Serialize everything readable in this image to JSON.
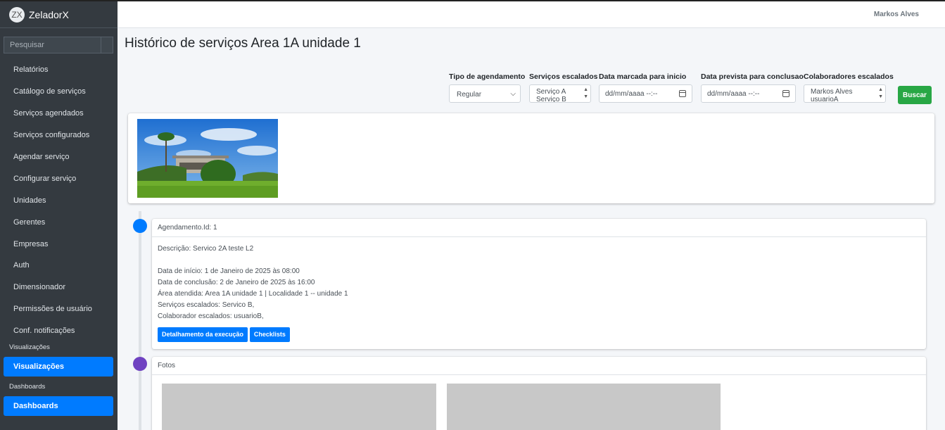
{
  "brand": {
    "logo": "ZX",
    "name": "ZeladorX"
  },
  "search": {
    "placeholder": "Pesquisar"
  },
  "nav": {
    "items": [
      "Relatórios",
      "Catálogo de serviços",
      "Serviços agendados",
      "Serviços configurados",
      "Agendar serviço",
      "Configurar serviço",
      "Unidades",
      "Gerentes",
      "Empresas",
      "Auth",
      "Dimensionador",
      "Permissões de usuário",
      "Conf. notificações"
    ],
    "section_visualizacoes": "Visualizações",
    "item_visualizacoes": "Visualizações",
    "section_dashboards": "Dashboards",
    "item_dashboards": "Dashboards"
  },
  "header": {
    "user": "Markos Alves"
  },
  "page": {
    "title": "Histórico de serviços Area 1A unidade 1"
  },
  "filters": {
    "tipo": {
      "label": "Tipo de agendamento",
      "value": "Regular"
    },
    "servicos": {
      "label": "Serviços escalados",
      "options": [
        "Serviço A",
        "Serviço B"
      ]
    },
    "data_inicio": {
      "label": "Data marcada para inicio",
      "placeholder": "dd/mm/aaaa --:--"
    },
    "data_fim": {
      "label": "Data prevista para conclusao",
      "placeholder": "dd/mm/aaaa --:--"
    },
    "colaboradores": {
      "label": "Colaboradores escalados",
      "options": [
        "Markos Alves",
        "usuarioA"
      ]
    },
    "buscar": "Buscar"
  },
  "timeline": {
    "agendamento": {
      "header": "Agendamento.Id: 1",
      "descricao": "Descrição: Servico 2A teste L2",
      "inicio": "Data de início: 1 de Janeiro de 2025 às 08:00",
      "conclusao": "Data de conclusão: 2 de Janeiro de 2025 às 16:00",
      "area": "Área atendida: Area 1A unidade 1 | Localidade 1 -- unidade 1",
      "servicos": "Serviços escalados: Servico B,",
      "colaborador": "Colaborador escalados: usuarioB,",
      "btn_detalhamento": "Detalhamento da execução",
      "btn_checklists": "Checklists"
    },
    "fotos": {
      "header": "Fotos"
    }
  },
  "colors": {
    "sidebar": "#343a40",
    "primary": "#007bff",
    "success": "#28a745",
    "dot1": "#007bff",
    "dot2": "#6f42c1"
  }
}
